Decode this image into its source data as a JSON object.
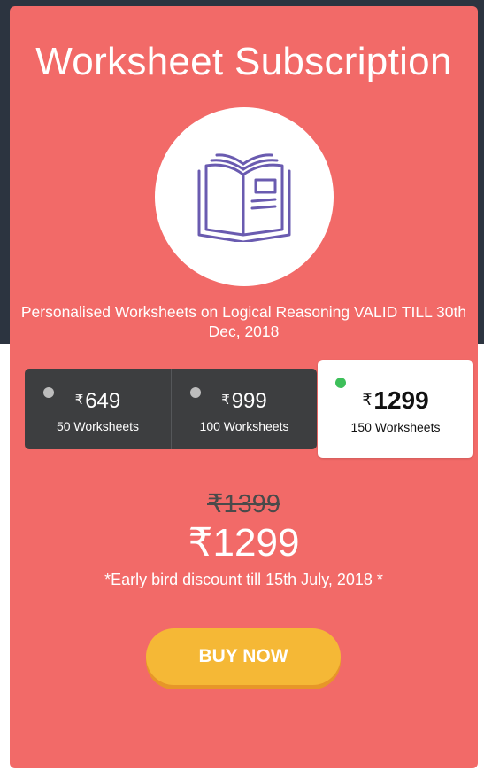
{
  "colors": {
    "card_background": "#f26a68",
    "page_background_top": "#2c3440",
    "plans_background": "#3d3e40",
    "selected_indicator": "#3dbf5a",
    "unselected_indicator": "#bdbdbd",
    "button": "#f5b836",
    "icon_stroke": "#6a5bb0"
  },
  "header": {
    "title": "Worksheet Subscription",
    "icon": "open-book-icon"
  },
  "description": "Personalised Worksheets on Logical Reasoning VALID TILL 30th Dec, 2018",
  "currency_symbol": "₹",
  "plans": [
    {
      "price": "649",
      "label": "50 Worksheets",
      "selected": false
    },
    {
      "price": "999",
      "label": "100 Worksheets",
      "selected": false
    },
    {
      "price": "1299",
      "label": "150 Worksheets",
      "selected": true
    }
  ],
  "pricing": {
    "original_price": "₹1399",
    "current_price": "₹1299",
    "discount_note": "*Early bird discount till 15th July, 2018 *"
  },
  "buy_button_label": "BUY NOW"
}
